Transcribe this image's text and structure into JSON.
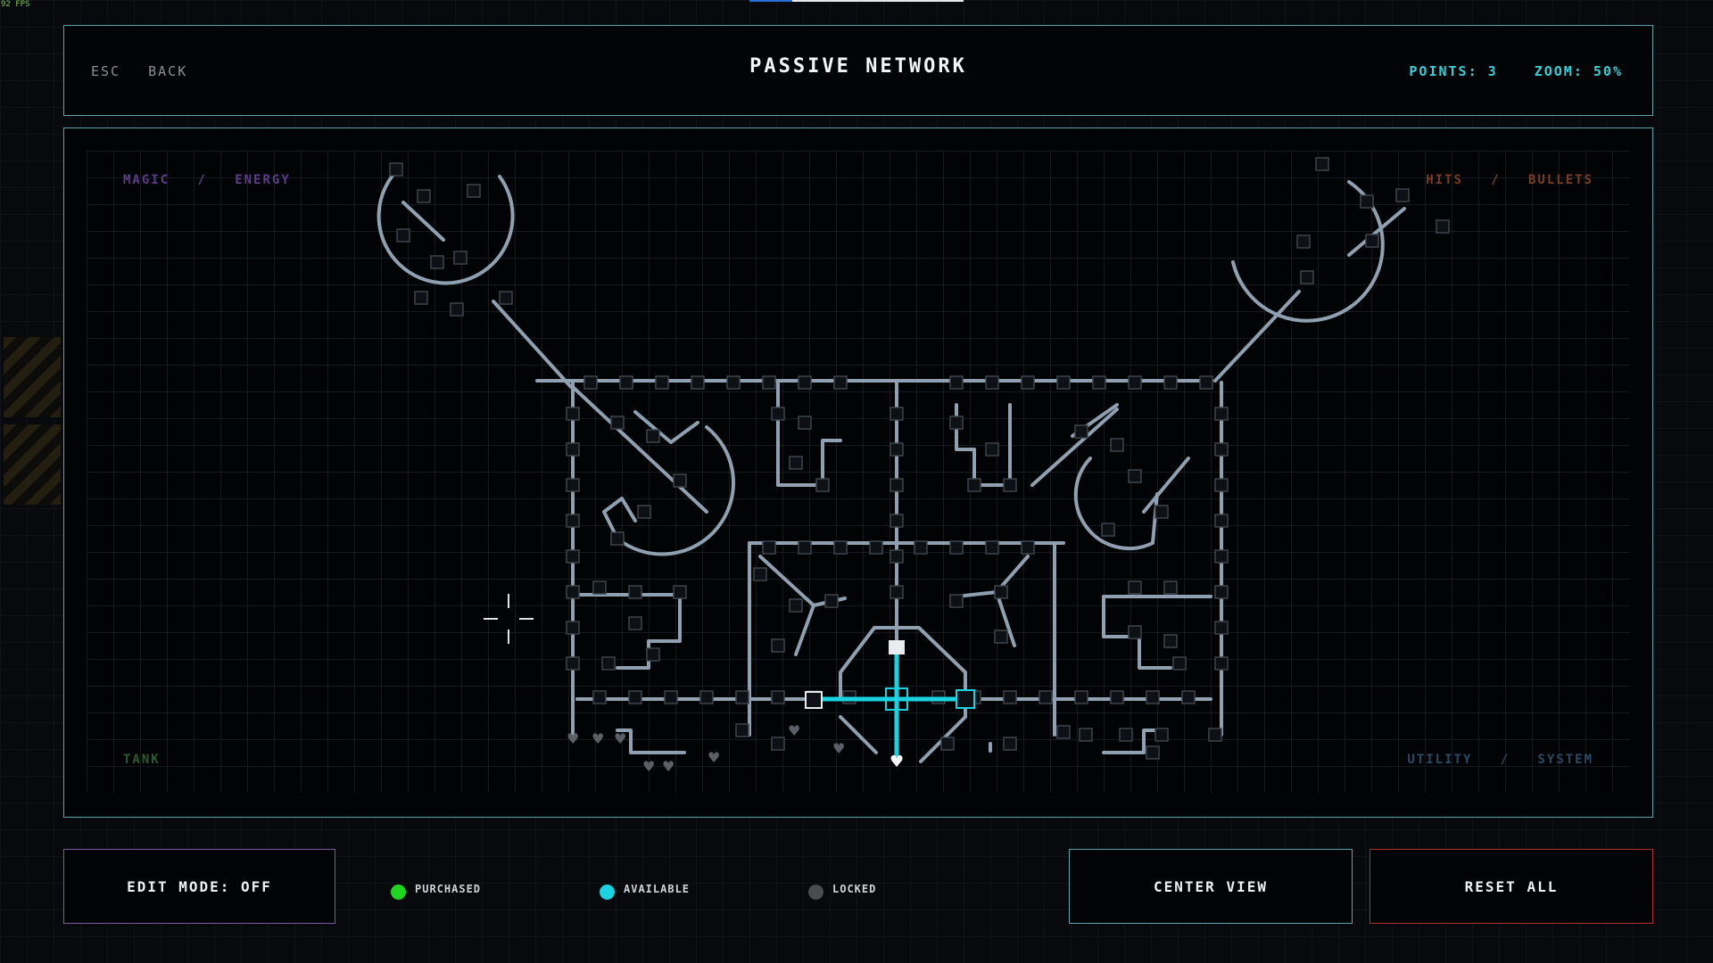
{
  "fps": "92 FPS",
  "header": {
    "esc_label": "ESC",
    "back_label": "BACK",
    "title": "PASSIVE NETWORK",
    "points": "POINTS: 3",
    "zoom": "ZOOM: 50%"
  },
  "corners": {
    "magic": "MAGIC",
    "energy": "ENERGY",
    "hits": "HITS",
    "bullets": "BULLETS",
    "tank": "TANK",
    "utility": "UTILITY",
    "system": "SYSTEM",
    "separator": "/"
  },
  "footer": {
    "edit_mode": "EDIT MODE: OFF",
    "center_view": "CENTER VIEW",
    "reset_all": "RESET ALL"
  },
  "legend": [
    {
      "label": "PURCHASED",
      "color": "#1ed61e"
    },
    {
      "label": "AVAILABLE",
      "color": "#19d3e0"
    },
    {
      "label": "LOCKED",
      "color": "#4a4d50"
    }
  ],
  "colors": {
    "accent_cyan": "#36cfd9",
    "path_gray": "#8fa0b0",
    "active_path": "#19d3e0",
    "reset_red": "#b0302a",
    "edit_purple": "#7c5aa6"
  }
}
